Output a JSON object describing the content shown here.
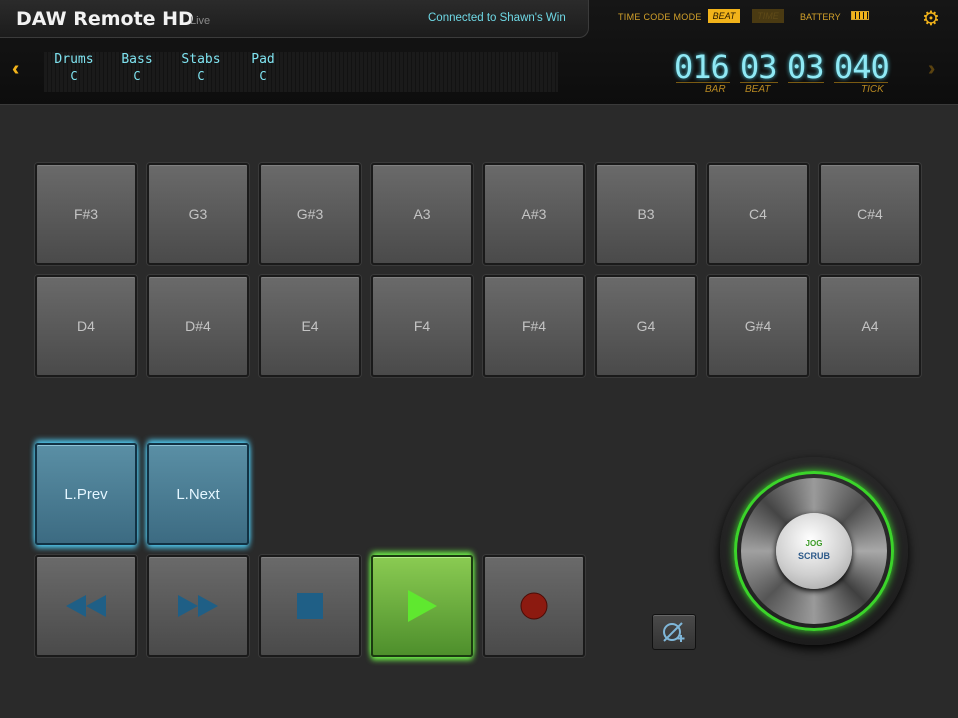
{
  "header": {
    "app_title": "DAW Remote HD",
    "app_subtitle": "Live",
    "connection_status": "Connected to Shawn's Win",
    "time_code_mode_label": "TIME CODE MODE",
    "time_code_modes": [
      "BEAT",
      "TIME"
    ],
    "time_code_mode_selected": "BEAT",
    "battery_label": "BATTERY",
    "settings_icon": "gear-icon"
  },
  "tracks": [
    {
      "name": "Drums",
      "key": "C"
    },
    {
      "name": "Bass",
      "key": "C"
    },
    {
      "name": "Stabs",
      "key": "C"
    },
    {
      "name": "Pad",
      "key": "C"
    }
  ],
  "position": {
    "bar": "016",
    "beat": "03",
    "sub": "03",
    "tick": "040",
    "labels": {
      "bar": "BAR",
      "beat": "BEAT",
      "tick": "TICK"
    }
  },
  "pads": {
    "row1": [
      "F#3",
      "G3",
      "G#3",
      "A3",
      "A#3",
      "B3",
      "C4",
      "C#4"
    ],
    "row2": [
      "D4",
      "D#4",
      "E4",
      "F4",
      "F#4",
      "G4",
      "G#4",
      "A4"
    ]
  },
  "cue": {
    "prev": "L.Prev",
    "next": "L.Next"
  },
  "transport": {
    "rewind_icon": "rewind-icon",
    "forward_icon": "fast-forward-icon",
    "stop_icon": "stop-icon",
    "play_icon": "play-icon",
    "record_icon": "record-icon",
    "playing": true
  },
  "jog": {
    "label_top": "JOG",
    "label_bottom": "SCRUB"
  },
  "colors": {
    "accent_orange": "#f2b31a",
    "cyan_text": "#7fe3f0",
    "cue_blue": "#4fc7ee",
    "play_green": "#70f54a",
    "record_red": "#8c1a10"
  }
}
